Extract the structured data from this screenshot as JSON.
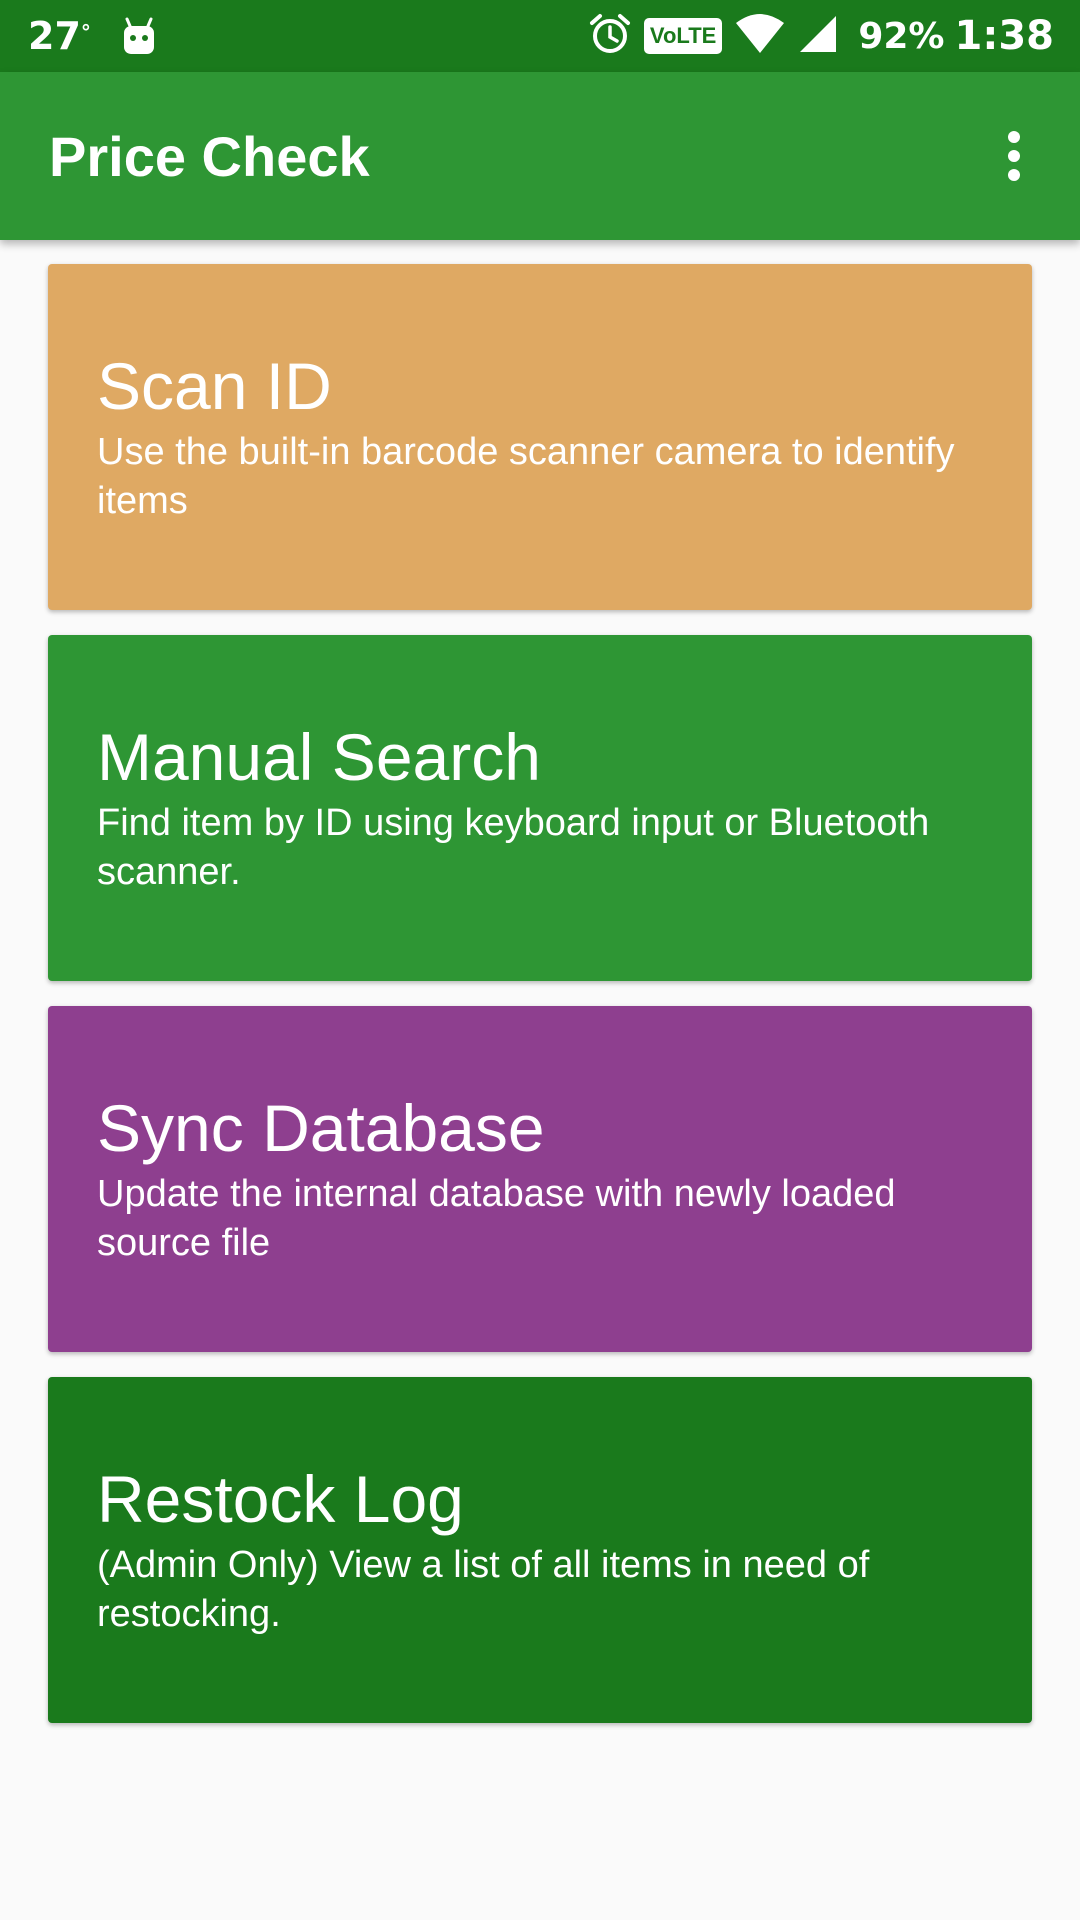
{
  "status_bar": {
    "temperature": "27",
    "degree_symbol": "°",
    "volte_label": "VoLTE",
    "battery": "92%",
    "time": "1:38",
    "icons": [
      "android-icon",
      "alarm-icon",
      "volte-icon",
      "wifi-icon",
      "signal-icon"
    ]
  },
  "app_bar": {
    "title": "Price Check",
    "menu_icon": "overflow-menu-icon"
  },
  "cards": [
    {
      "title": "Scan ID",
      "description": "Use the built-in barcode scanner camera to identify items",
      "color": "#dfa963"
    },
    {
      "title": "Manual Search",
      "description": "Find item by ID using keyboard input or Bluetooth scanner.",
      "color": "#2e9634"
    },
    {
      "title": "Sync Database",
      "description": "Update the internal database with newly loaded source file",
      "color": "#8e3f8f"
    },
    {
      "title": "Restock Log",
      "description": "(Admin Only) View a list of all items in need of restocking.",
      "color": "#1a7a1c"
    }
  ],
  "colors": {
    "status_bar": "#1a7a1c",
    "app_bar": "#2e9634",
    "background": "#fafafa"
  }
}
